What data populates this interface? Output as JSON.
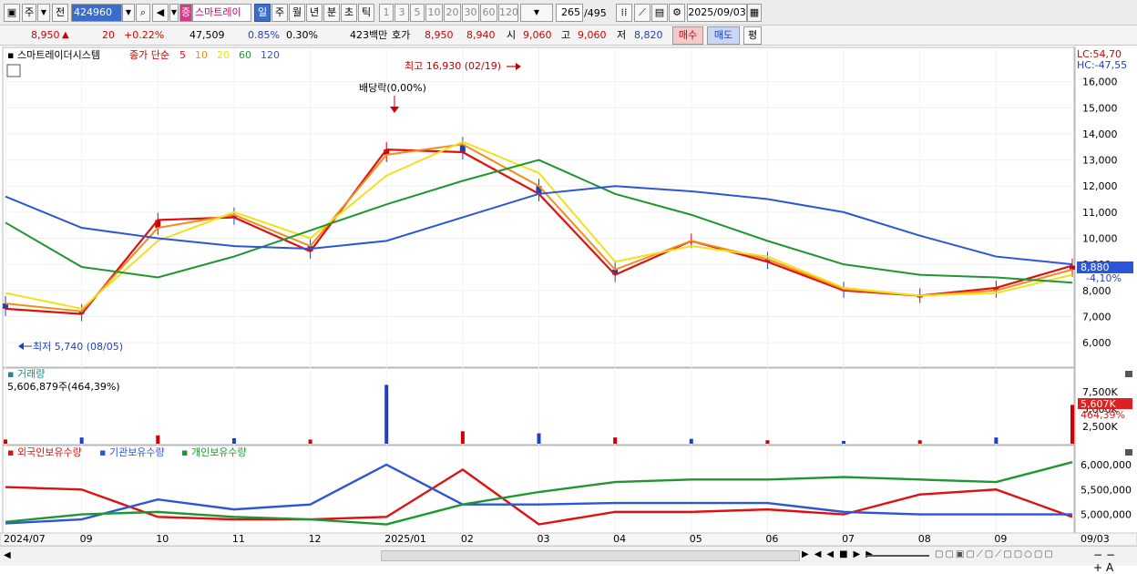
{
  "toolbar": {
    "market": "주",
    "period_prefix": "전",
    "code": "424960",
    "stock_badge": "증",
    "stock_name": "스마트레이",
    "periods": [
      "일",
      "주",
      "월",
      "년",
      "분",
      "초",
      "틱"
    ],
    "active_period": "일",
    "intervals": [
      "1",
      "3",
      "5",
      "10",
      "20",
      "30",
      "60",
      "120"
    ],
    "count": "265",
    "total": "/495",
    "date": "2025/09/03"
  },
  "quote": {
    "price": "8,950",
    "arrow": "▲",
    "change": "20",
    "change_pct": "+0.22%",
    "volume": "47,509",
    "vol_pct": "0.85%",
    "turnover_pct": "0.30%",
    "amount": "423백만",
    "bid_label": "호가",
    "ask": "8,950",
    "bid": "8,940",
    "open_label": "시",
    "open": "9,060",
    "high_label": "고",
    "high": "9,060",
    "low_label": "저",
    "low": "8,820",
    "buy_label": "매수",
    "sell_label": "매도",
    "avg_label": "평"
  },
  "price_panel": {
    "title": "스마트레이더시스템",
    "ma_label": "종가 단순",
    "ma_periods": [
      "5",
      "10",
      "20",
      "60",
      "120"
    ],
    "ma_colors": [
      "#e01010",
      "#f28c1a",
      "#f0e01e",
      "#1e9632",
      "#2d55d8"
    ],
    "lc": "LC:54,70",
    "hc": "HC:-47,55",
    "high_annotation": "최고 16,930 (02/19)",
    "low_annotation": "최저 5,740 (08/05)",
    "dividend_annotation": "배당락(0,00%)",
    "last_price_tag": "8,880",
    "last_pct_tag": "-4,10%",
    "y_ticks": [
      "16,000",
      "15,000",
      "14,000",
      "13,000",
      "12,000",
      "11,000",
      "10,000",
      "9,000",
      "8,000",
      "7,000",
      "6,000"
    ]
  },
  "volume_panel": {
    "title": "거래량",
    "summary": "5,606,879주(464,39%)",
    "last_tag": "5,607K",
    "last_pct": "464,39%",
    "y_ticks": [
      "7,500K",
      "5,000K",
      "2,500K"
    ]
  },
  "holding_panel": {
    "legend": [
      {
        "name": "외국인보유수량",
        "color": "#e01010"
      },
      {
        "name": "기관보유수량",
        "color": "#2d55d8"
      },
      {
        "name": "개인보유수량",
        "color": "#1e9632"
      }
    ],
    "y_ticks": [
      "6,000,000",
      "5,500,000",
      "5,000,000"
    ]
  },
  "x_axis": [
    "2024/07",
    "09",
    "10",
    "11",
    "12",
    "2025/01",
    "02",
    "03",
    "04",
    "05",
    "06",
    "07",
    "08",
    "09",
    "09/03"
  ],
  "chart_data": [
    {
      "type": "line",
      "name_ref": "price_panel",
      "ylim": [
        5200,
        17000
      ],
      "x": [
        "2024/07",
        "09",
        "10",
        "11",
        "12",
        "2025/01",
        "02",
        "03",
        "04",
        "05",
        "06",
        "07",
        "08",
        "09",
        "09/03"
      ],
      "series": [
        {
          "name": "5",
          "values": [
            7300,
            7100,
            10700,
            10800,
            9500,
            13400,
            13300,
            11700,
            8600,
            9900,
            9100,
            8000,
            7800,
            8100,
            8950
          ]
        },
        {
          "name": "10",
          "values": [
            7500,
            7200,
            10400,
            10900,
            9700,
            13200,
            13600,
            12000,
            8800,
            9900,
            9200,
            8050,
            7800,
            8000,
            8800
          ]
        },
        {
          "name": "20",
          "values": [
            7900,
            7300,
            9900,
            11000,
            10000,
            12400,
            13700,
            12500,
            9100,
            9700,
            9300,
            8100,
            7800,
            7900,
            8600
          ]
        },
        {
          "name": "60",
          "values": [
            10600,
            8900,
            8500,
            9300,
            10300,
            11300,
            12200,
            13000,
            11700,
            10900,
            9900,
            9000,
            8600,
            8500,
            8300
          ]
        },
        {
          "name": "120",
          "values": [
            11600,
            10400,
            10000,
            9700,
            9600,
            9900,
            10800,
            11700,
            12000,
            11800,
            11500,
            11000,
            10100,
            9300,
            9000
          ]
        }
      ]
    },
    {
      "type": "bar",
      "name_ref": "volume_panel",
      "ylim": [
        0,
        10000
      ],
      "x": [
        "2024/07",
        "09",
        "10",
        "11",
        "12",
        "2025/01",
        "02",
        "03",
        "04",
        "05",
        "06",
        "07",
        "08",
        "09",
        "09/03"
      ],
      "values": [
        600,
        900,
        1200,
        800,
        600,
        8500,
        1800,
        1500,
        900,
        700,
        500,
        400,
        500,
        900,
        5607
      ]
    },
    {
      "type": "line",
      "name_ref": "holding_panel",
      "ylim": [
        4700000,
        6200000
      ],
      "x": [
        "2024/07",
        "09",
        "10",
        "11",
        "12",
        "2025/01",
        "02",
        "03",
        "04",
        "05",
        "06",
        "07",
        "08",
        "09",
        "09/03"
      ],
      "series": [
        {
          "name": "외국인보유수량",
          "values": [
            5550000,
            5500000,
            4950000,
            4900000,
            4900000,
            4950000,
            5900000,
            4800000,
            5050000,
            5050000,
            5100000,
            5000000,
            5400000,
            5500000,
            4950000
          ]
        },
        {
          "name": "기관보유수량",
          "values": [
            4820000,
            4900000,
            5300000,
            5100000,
            5200000,
            6000000,
            5200000,
            5200000,
            5230000,
            5230000,
            5230000,
            5050000,
            5000000,
            5000000,
            5000000
          ]
        },
        {
          "name": "개인보유수량",
          "values": [
            4850000,
            5000000,
            5050000,
            4950000,
            4900000,
            4800000,
            5200000,
            5450000,
            5650000,
            5700000,
            5700000,
            5750000,
            5700000,
            5650000,
            6050000
          ]
        }
      ]
    }
  ]
}
